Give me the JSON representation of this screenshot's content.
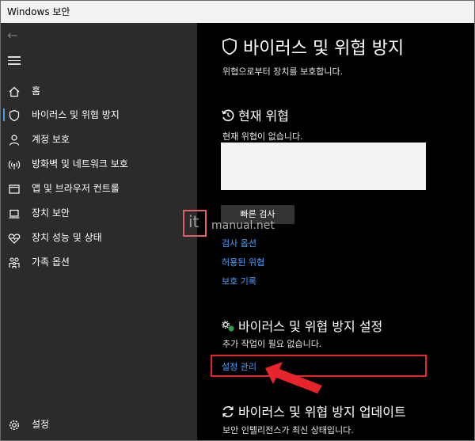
{
  "window": {
    "title": "Windows 보안"
  },
  "sidebar": {
    "items": [
      {
        "label": "홈",
        "icon": "home-icon"
      },
      {
        "label": "바이러스 및 위협 방지",
        "icon": "shield-icon",
        "active": true
      },
      {
        "label": "계정 보호",
        "icon": "person-icon"
      },
      {
        "label": "방화벽 및 네트워크 보호",
        "icon": "wifi-icon"
      },
      {
        "label": "앱 및 브라우저 컨트롤",
        "icon": "app-window-icon"
      },
      {
        "label": "장치 보안",
        "icon": "laptop-icon"
      },
      {
        "label": "장치 성능 및 상태",
        "icon": "heart-icon"
      },
      {
        "label": "가족 옵션",
        "icon": "family-icon"
      }
    ],
    "settings_label": "설정"
  },
  "main": {
    "title": "바이러스 및 위협 방지",
    "subtitle": "위협으로부터 장치를 보호합니다.",
    "current_threats": {
      "title": "현재 위협",
      "status": "현재 위협이 없습니다.",
      "quick_scan_label": "빠른 검사",
      "links": [
        "검사 옵션",
        "허용된 위협",
        "보호 기록"
      ]
    },
    "protection_settings": {
      "title": "바이러스 및 위협 방지 설정",
      "status": "추가 작업이 필요 없습니다.",
      "manage_link": "설정 관리"
    },
    "updates": {
      "title": "바이러스 및 위협 방지 업데이트",
      "status": "보안 인텔리전스가 최신 상태입니다."
    }
  },
  "watermark": {
    "letter": "it",
    "text": "manual.net"
  },
  "colors": {
    "accent": "#4aa0ff",
    "highlight": "#e8242b",
    "sidebar_bg": "#2b2b2b"
  }
}
